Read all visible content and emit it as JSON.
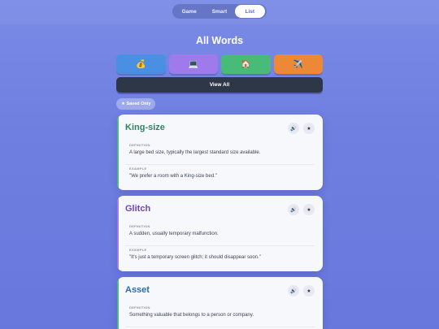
{
  "nav": {
    "tabs": [
      {
        "label": "Game"
      },
      {
        "label": "Smart"
      },
      {
        "label": "List"
      }
    ],
    "active": "List"
  },
  "page_title": "All Words",
  "categories": [
    {
      "icon": "money-bag-icon",
      "glyph": "💰",
      "color": "#4a90e2"
    },
    {
      "icon": "laptop-icon",
      "glyph": "💻",
      "color": "#9f7aea"
    },
    {
      "icon": "house-icon",
      "glyph": "🏠",
      "color": "#48bb78"
    },
    {
      "icon": "airplane-icon",
      "glyph": "✈️",
      "color": "#ed8936"
    }
  ],
  "view_all_label": "View All",
  "saved_only_label": "★ Saved Only",
  "cards": [
    {
      "word": "King-size",
      "word_color": "#2f855a",
      "stripe_color": "#48bb78",
      "definition_label": "DEFINITION",
      "definition": "A large bed size, typically the largest standard size available.",
      "example_label": "EXAMPLE",
      "example": "\"We prefer a room with a King-size bed.\"",
      "speaker_glyph": "🔊",
      "star_glyph": "★"
    },
    {
      "word": "Glitch",
      "word_color": "#6b46c1",
      "stripe_color": "#9f7aea",
      "definition_label": "DEFINITION",
      "definition": "A sudden, usually temporary malfunction.",
      "example_label": "EXAMPLE",
      "example": "\"It's just a temporary screen glitch; it should disappear soon.\"",
      "speaker_glyph": "🔊",
      "star_glyph": "★"
    },
    {
      "word": "Asset",
      "word_color": "#2b6cb0",
      "stripe_color": "#48bb78",
      "definition_label": "DEFINITION",
      "definition": "Something valuable that belongs to a person or company.",
      "speaker_glyph": "🔊",
      "star_glyph": "★"
    }
  ]
}
